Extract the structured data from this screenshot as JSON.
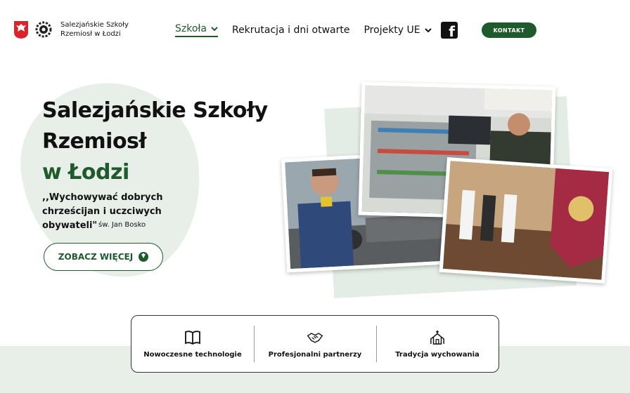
{
  "header": {
    "logo_line1": "Salezjańskie Szkoły",
    "logo_line2": "Rzemiosł w Łodzi",
    "eagle_icon": "polish-eagle-icon",
    "gear_icon": "gear-logo-icon",
    "nav": [
      {
        "label": "Szkoła",
        "has_dropdown": true,
        "active": true
      },
      {
        "label": "Rekrutacja i dni otwarte",
        "has_dropdown": false
      },
      {
        "label": "Projekty UE",
        "has_dropdown": true
      }
    ],
    "facebook_icon": "facebook-icon",
    "contact_label": "KONTAKT",
    "accent": "#1e5a2c"
  },
  "hero": {
    "title_line1": "Salezjańskie Szkoły",
    "title_line2": "Rzemiosł",
    "title_line3": "w Łodzi",
    "quote": ",,Wychowywać dobrych chrześcijan i uczciwych obywateli\"",
    "author": "św. Jan Bosko",
    "cta_label": "ZOBACZ WIĘCEJ",
    "cta_icon": "arrow-down-circle-icon",
    "blob_color": "#e8efe9"
  },
  "features": [
    {
      "label": "Nowoczesne technologie",
      "icon": "open-book-icon"
    },
    {
      "label": "Profesjonalni partnerzy",
      "icon": "handshake-icon"
    },
    {
      "label": "Tradycja wychowania",
      "icon": "church-icon"
    }
  ]
}
